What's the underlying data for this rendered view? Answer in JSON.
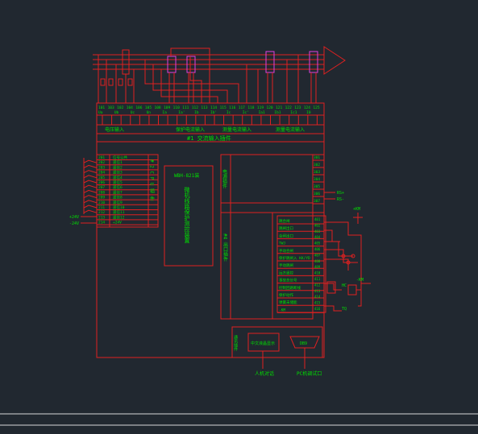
{
  "colors": {
    "background": "#212830",
    "lines": "#e02020",
    "text": "#00e000",
    "bus": "#e040e0",
    "frame": "#d8d8d8"
  },
  "top_terminals": {
    "numbers": [
      "101",
      "103",
      "102",
      "104",
      "106",
      "105",
      "108",
      "109",
      "110",
      "111",
      "112",
      "113",
      "114",
      "115",
      "116",
      "117",
      "118",
      "119",
      "120",
      "121",
      "122",
      "123",
      "124",
      "125"
    ],
    "names": [
      "Ua",
      "Ub",
      "Uc",
      "Un",
      "Ia",
      "Ia'",
      "Ib",
      "Ib'",
      "Ic",
      "Ic'",
      "Ia1",
      "Ib1",
      "Ic1",
      "I0"
    ]
  },
  "groups": {
    "voltage_input": "电压输入",
    "protect_current": "保护电流输入",
    "measure_current_1": "测量电流输入",
    "measure_current_2": "测量电流输入"
  },
  "module_title": "#1   交流输入插件",
  "left_terminals": [
    "201",
    "202",
    "203",
    "204",
    "205",
    "206",
    "207",
    "208",
    "209",
    "210",
    "211",
    "212",
    "213",
    "214"
  ],
  "left_labels": [
    "信号公共",
    "遥信1",
    "遥信2",
    "遥信3",
    "遥信4",
    "遥信5",
    "遥信6",
    "遥信7",
    "遥信8",
    "遥信9",
    "遥信10",
    "遥信11",
    "遥信12",
    "+24V"
  ],
  "left_power": [
    "+24V",
    "-24V"
  ],
  "cpu_label": "# 2 C P U 插 件",
  "device_label": "WBH-821装",
  "device_desc": "微机线路保护测控装置",
  "power_label": "电源插件",
  "right_top_terminals": [
    "301",
    "302",
    "303",
    "304",
    "305",
    "306",
    "307"
  ],
  "right_top_signals": [
    "RS+",
    "RS-"
  ],
  "rs_label": "RS485",
  "plus_km": "+KM",
  "minus_km": "-KM",
  "output_labels": [
    "跳合闸",
    "跳闸出口",
    "合闸出口",
    "TWJ",
    "手动合闸",
    "保护跳闸入 KK/YD",
    "手动跳闸",
    "远方遥控",
    "事故总信号",
    "控制回路断线",
    "保护动作",
    "弹簧未储能",
    "-KM"
  ],
  "output_terminals": [
    "401",
    "402",
    "403",
    "404",
    "405",
    "406",
    "407",
    "408",
    "409",
    "410",
    "411",
    "412",
    "413",
    "414",
    "415",
    "416"
  ],
  "coil_labels": [
    "HC",
    "TQ"
  ],
  "bottom_label": "通讯插件",
  "chinese_display": "中文液晶显示",
  "db9": "DB9",
  "bottom_captions": [
    "人机对话",
    "PC机调试口"
  ]
}
